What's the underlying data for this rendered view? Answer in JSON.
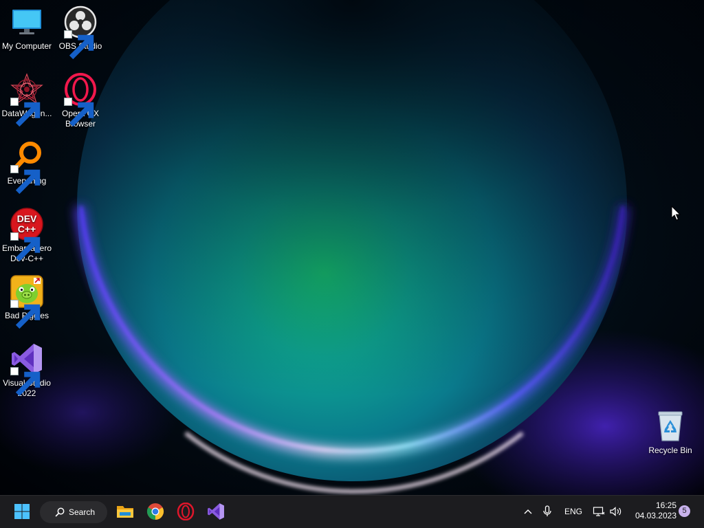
{
  "desktop": {
    "icons": [
      {
        "label": "My Computer",
        "icon": "monitor-icon",
        "shortcut": false
      },
      {
        "label": "OBS Studio",
        "icon": "obs-studio-icon",
        "shortcut": true
      },
      {
        "label": "DataWagon...",
        "icon": "datawagon-icon",
        "shortcut": true
      },
      {
        "label": "Opera GX Browser",
        "icon": "opera-gx-icon",
        "shortcut": true
      },
      {
        "label": "Everything",
        "icon": "everything-search-icon",
        "shortcut": true
      },
      {
        "label": "Embarcadero Dev-C++",
        "icon": "dev-cpp-icon",
        "shortcut": true,
        "badge_text": "DEV C++"
      },
      {
        "label": "Bad Piggies",
        "icon": "bad-piggies-icon",
        "shortcut": true
      },
      {
        "label": "Visual Studio 2022",
        "icon": "visual-studio-icon",
        "shortcut": true
      },
      {
        "label": "Recycle Bin",
        "icon": "recycle-bin-icon",
        "shortcut": false
      }
    ]
  },
  "taskbar": {
    "search_label": "Search",
    "pinned": [
      {
        "name": "start",
        "icon": "windows-start-icon"
      },
      {
        "name": "file-explorer",
        "icon": "folder-icon"
      },
      {
        "name": "chrome",
        "icon": "chrome-icon"
      },
      {
        "name": "opera",
        "icon": "opera-icon"
      },
      {
        "name": "visual-studio",
        "icon": "visual-studio-icon"
      }
    ],
    "tray": {
      "language": "ENG",
      "time": "16:25",
      "date": "04.03.2023",
      "notification_count": "5"
    }
  },
  "colors": {
    "taskbar_bg": "#1c1c1f",
    "accent_cyan": "#00c2d4",
    "accent_purple": "#6f3fe0",
    "badge": "#c8b2ec"
  }
}
